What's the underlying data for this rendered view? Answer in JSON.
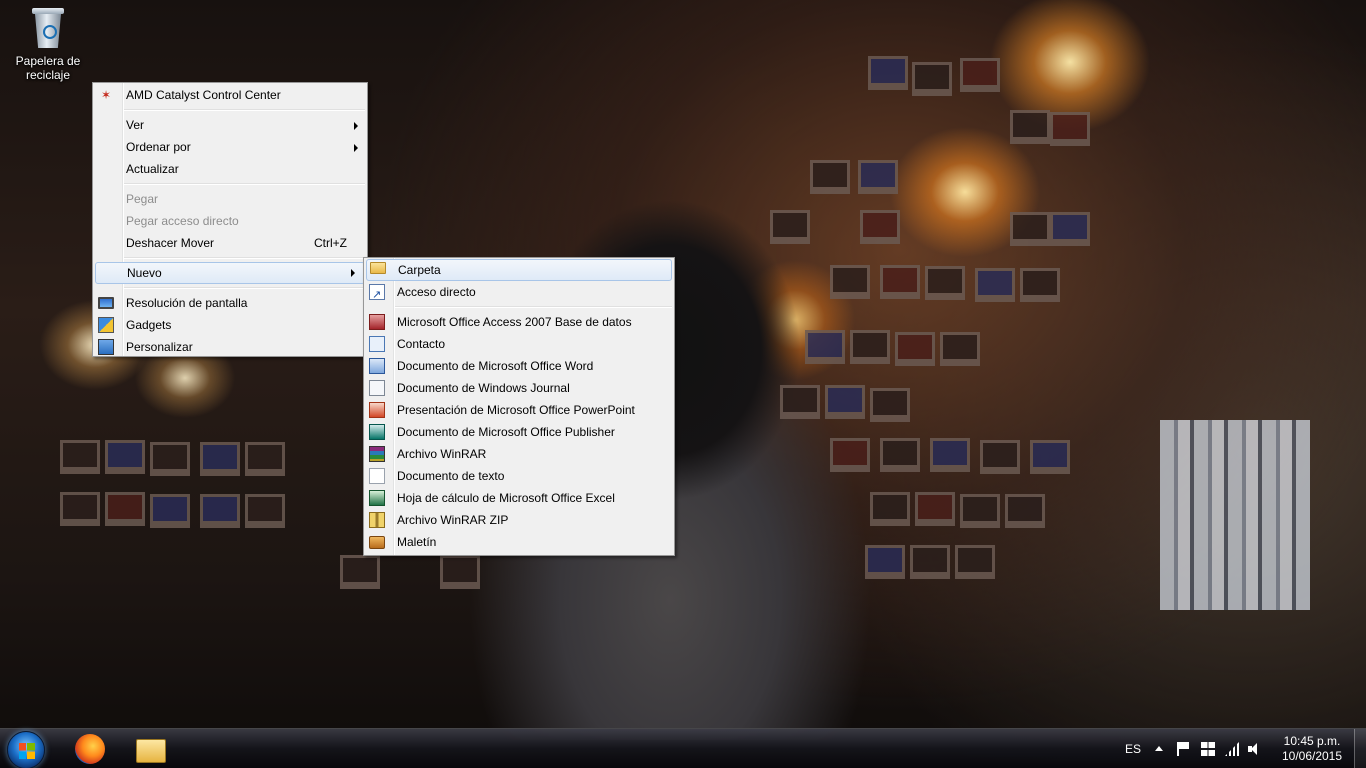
{
  "desktop": {
    "icons": [
      {
        "label": "Papelera de reciclaje",
        "icon": "recycle-bin-icon"
      }
    ]
  },
  "context_menu": {
    "items": [
      {
        "label": "AMD Catalyst Control Center",
        "icon": "amd-icon"
      },
      {
        "label": "Ver",
        "submenu": true
      },
      {
        "label": "Ordenar por",
        "submenu": true
      },
      {
        "label": "Actualizar"
      },
      {
        "label": "Pegar",
        "disabled": true
      },
      {
        "label": "Pegar acceso directo",
        "disabled": true
      },
      {
        "label": "Deshacer Mover",
        "shortcut": "Ctrl+Z"
      },
      {
        "label": "Nuevo",
        "submenu": true,
        "highlighted": true
      },
      {
        "label": "Resolución de pantalla",
        "icon": "display-icon"
      },
      {
        "label": "Gadgets",
        "icon": "gadgets-icon"
      },
      {
        "label": "Personalizar",
        "icon": "personalize-icon"
      }
    ]
  },
  "new_submenu": {
    "items": [
      {
        "label": "Carpeta",
        "icon": "folder-icon",
        "highlighted": true
      },
      {
        "label": "Acceso directo",
        "icon": "shortcut-icon"
      },
      {
        "label": "Microsoft Office Access 2007 Base de datos",
        "icon": "access-icon"
      },
      {
        "label": "Contacto",
        "icon": "contact-icon"
      },
      {
        "label": "Documento de Microsoft Office Word",
        "icon": "word-icon"
      },
      {
        "label": "Documento de Windows Journal",
        "icon": "journal-icon"
      },
      {
        "label": "Presentación de Microsoft Office PowerPoint",
        "icon": "powerpoint-icon"
      },
      {
        "label": "Documento de Microsoft Office Publisher",
        "icon": "publisher-icon"
      },
      {
        "label": "Archivo WinRAR",
        "icon": "winrar-icon"
      },
      {
        "label": "Documento de texto",
        "icon": "text-document-icon"
      },
      {
        "label": "Hoja de cálculo de Microsoft Office Excel",
        "icon": "excel-icon"
      },
      {
        "label": "Archivo WinRAR ZIP",
        "icon": "zip-icon"
      },
      {
        "label": "Maletín",
        "icon": "briefcase-icon"
      }
    ]
  },
  "taskbar": {
    "pinned": [
      {
        "name": "Firefox",
        "icon": "firefox-icon"
      },
      {
        "name": "Explorador de Windows",
        "icon": "file-explorer-icon"
      }
    ],
    "tray": {
      "language": "ES",
      "time": "10:45 p.m.",
      "date": "10/06/2015"
    }
  },
  "colors": {
    "menu_background": "#f0f0f0",
    "menu_highlight_border": "#a8c5e8",
    "disabled_text": "#8d8d8d"
  }
}
